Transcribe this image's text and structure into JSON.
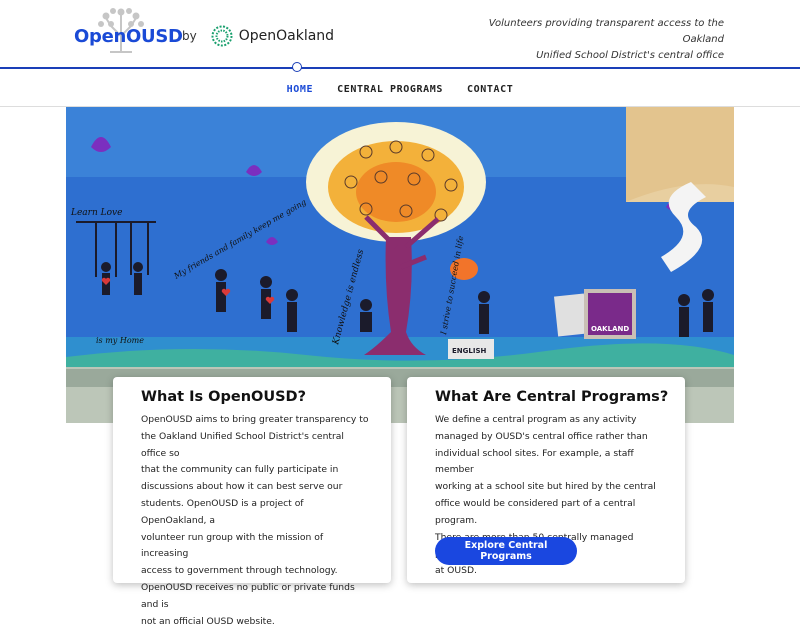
{
  "brand": {
    "logo_text": "OpenOUSD",
    "by": "by",
    "partner": "OpenOakland"
  },
  "tagline": {
    "line1": "Volunteers providing transparent access to the Oakland",
    "line2": "Unified School District's central office"
  },
  "nav": {
    "items": [
      {
        "label": "HOME",
        "active": true
      },
      {
        "label": "CENTRAL PROGRAMS",
        "active": false
      },
      {
        "label": "CONTACT",
        "active": false
      }
    ]
  },
  "hero": {
    "icon": "mural-image",
    "mural_texts": [
      "Learn Love",
      "My friends and family keep me going",
      "Knowledge is endless",
      "I strive to succeed in life",
      "ENGLISH",
      "OAKLAND",
      "is my Home"
    ]
  },
  "cards": [
    {
      "title": "What Is OpenOUSD?",
      "lines": [
        "OpenOUSD aims to bring greater transparency to",
        "the Oakland Unified School District's central office so",
        "that the community can fully participate in",
        "discussions about how it can best serve our",
        "students. OpenOUSD is a project of OpenOakland, a",
        "volunteer run group with the mission of increasing",
        "access to government through technology.",
        "OpenOUSD receives no public or private funds and is",
        "not an official OUSD website."
      ]
    },
    {
      "title": "What Are Central Programs?",
      "lines": [
        "We define a central program as any activity",
        "managed by OUSD's central office rather than",
        "individual school sites. For example, a staff member",
        "working at a school site but hired by the central",
        "office would be considered part of a central program.",
        "There are more than 50 centrally managed programs",
        "at OUSD."
      ],
      "button": "Explore Central Programs"
    }
  ],
  "colors": {
    "accent": "#1a47e0",
    "brand": "#1a4ad6",
    "partner": "#1aa06e"
  }
}
